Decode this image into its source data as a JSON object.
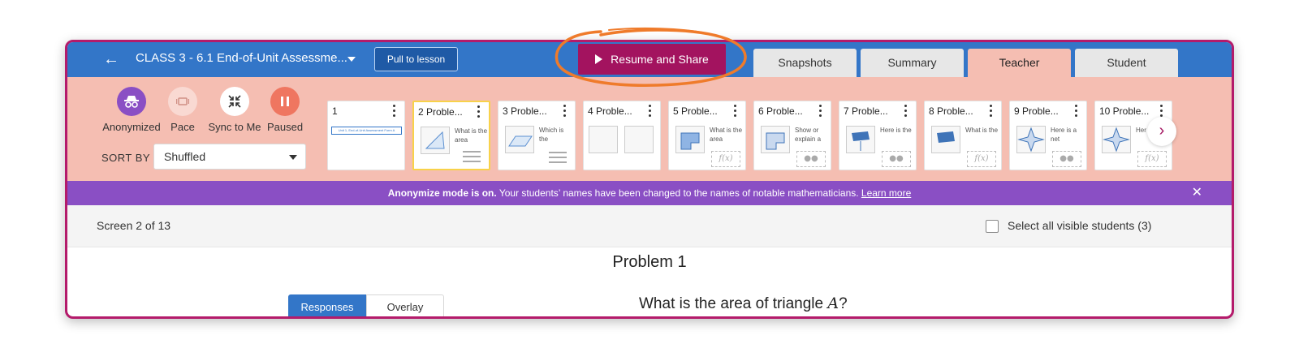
{
  "header": {
    "class_title": "CLASS 3 - 6.1 End-of-Unit Assessme...",
    "pull_label": "Pull to lesson",
    "resume_label": "Resume and Share",
    "tabs": [
      {
        "label": "Snapshots",
        "active": false
      },
      {
        "label": "Summary",
        "active": false
      },
      {
        "label": "Teacher",
        "active": true
      },
      {
        "label": "Student",
        "active": false
      }
    ]
  },
  "controls": {
    "anonymized": "Anonymized",
    "pace": "Pace",
    "sync": "Sync to Me",
    "paused": "Paused",
    "sort_by": "SORT BY",
    "sort_value": "Shuffled"
  },
  "screens": [
    {
      "num": "1",
      "snippet": "Unit 1, End-of-Unit Assessment Form A"
    },
    {
      "num": "2 Proble...",
      "snippet": "What is the area"
    },
    {
      "num": "3 Proble...",
      "snippet": "Which is the"
    },
    {
      "num": "4 Proble...",
      "snippet": ""
    },
    {
      "num": "5 Proble...",
      "snippet": "What is the area",
      "fx": "f(x)"
    },
    {
      "num": "6 Proble...",
      "snippet": "Show or explain a"
    },
    {
      "num": "7 Proble...",
      "snippet": "Here is the"
    },
    {
      "num": "8 Proble...",
      "snippet": "What is the",
      "fx": "f(x)"
    },
    {
      "num": "9 Proble...",
      "snippet": "Here is a net"
    },
    {
      "num": "10 Proble...",
      "snippet": "Her net",
      "fx": "f(x)"
    }
  ],
  "banner": {
    "bold": "Anonymize mode is on.",
    "text": " Your students’ names have been changed to the names of notable mathematicians. ",
    "link": "Learn more"
  },
  "screen_bar": {
    "count": "Screen 2 of 13",
    "select_all": "Select all visible students (3)"
  },
  "main": {
    "problem_title": "Problem 1",
    "responses": "Responses",
    "overlay": "Overlay",
    "question_prefix": "What is the area of triangle ",
    "question_var": "A",
    "question_suffix": "?"
  },
  "colors": {
    "topbar": "#3376c8",
    "resume": "#a3135f",
    "toolbar": "#f5beb2",
    "banner": "#8a4fc4",
    "annotation": "#ef7b2b"
  }
}
